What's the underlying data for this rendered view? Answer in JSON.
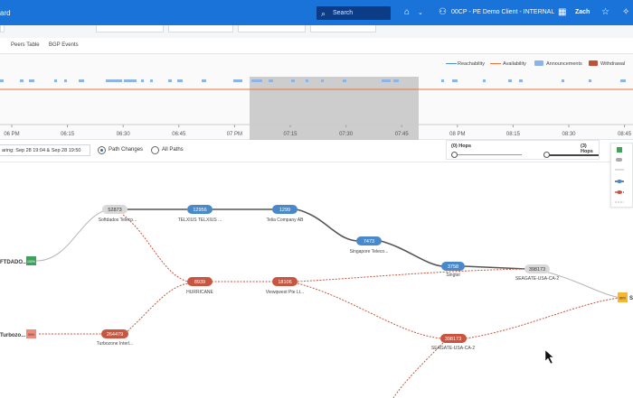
{
  "header": {
    "brand": "ard",
    "search_placeholder": "Search",
    "org": "00CP - PE Demo Client - INTERNAL",
    "user": "Zach"
  },
  "tabs": [
    "Peers Table",
    "BGP Events"
  ],
  "timeline": {
    "legend": {
      "reachability": "Reachability",
      "availability": "Availability",
      "announcements": "Announcements",
      "withdrawal": "Withdrawal"
    },
    "ticks": [
      "06 PM",
      "06:15",
      "06:30",
      "06:45",
      "07 PM",
      "07:15",
      "07:30",
      "07:45",
      "08 PM",
      "08:15",
      "08:30",
      "08:45"
    ],
    "colors": {
      "reachability": "#4a90d9",
      "availability": "#e8743b",
      "announcement": "#8db4e6",
      "withdrawal": "#c0503c",
      "selection": "#bdbdbd"
    }
  },
  "controls": {
    "date_range": "aring: Sep 28 19:04 & Sep 28 19:50",
    "path_changes": "Path Changes",
    "all_paths": "All Paths",
    "hops_min": "(0) Hops",
    "hops_max": "(3) Hops"
  },
  "graph": {
    "colors": {
      "blue": "#4a89c9",
      "red": "#c8553f",
      "gray": "#d8d8d8",
      "green": "#3ea35a",
      "orange": "#f5b634",
      "pink": "#f08a7e"
    },
    "sources": [
      {
        "label": "FTDADO...",
        "badge": "100%"
      },
      {
        "label": "Turbozo...",
        "badge": "90%"
      }
    ],
    "nodes": [
      {
        "id": "52873",
        "label": "Softdados Teleco..."
      },
      {
        "id": "12956",
        "label": "TELXIUS TELXIUS ..."
      },
      {
        "id": "1299",
        "label": "Telia Company AB"
      },
      {
        "id": "7473",
        "label": "Singapore Teleco..."
      },
      {
        "id": "3758",
        "label": "Singtel"
      },
      {
        "id": "398173",
        "label": "SEAGATE-USA-CA-2"
      },
      {
        "id": "8939",
        "label": "HURRICANE"
      },
      {
        "id": "18106",
        "label": "Viewqwest Pte Lt..."
      },
      {
        "id": "264479",
        "label": "Turbozone Interl..."
      },
      {
        "id": "398173",
        "label": "SEAGATE-USA-CA-2"
      }
    ],
    "target_badge": "86%",
    "target_label": "S"
  }
}
